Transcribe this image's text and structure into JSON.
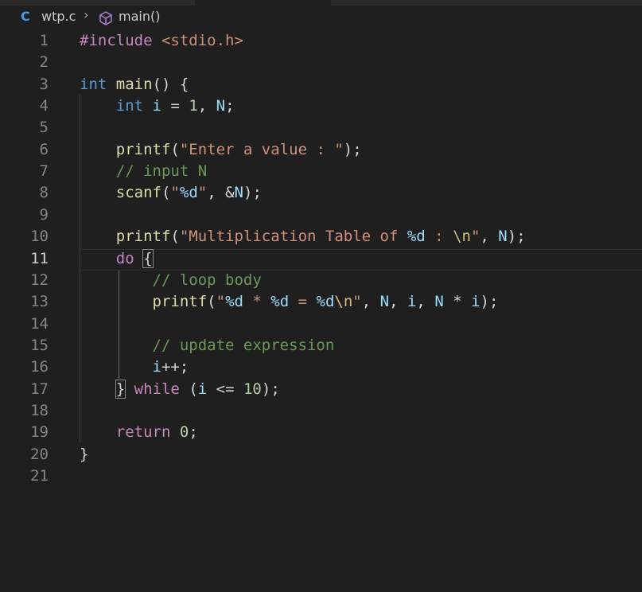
{
  "breadcrumb": {
    "lang_icon": "C",
    "file": "wtp.c",
    "separator": "›",
    "symbol_icon": "cube-icon",
    "symbol": "main()"
  },
  "editor": {
    "current_line": 11,
    "lines": [
      {
        "n": "1",
        "tokens": [
          {
            "t": "#include ",
            "c": "pre"
          },
          {
            "t": "<stdio.h>",
            "c": "str"
          }
        ]
      },
      {
        "n": "2",
        "tokens": []
      },
      {
        "n": "3",
        "tokens": [
          {
            "t": "int",
            "c": "kw"
          },
          {
            "t": " ",
            "c": "txt"
          },
          {
            "t": "main",
            "c": "fn"
          },
          {
            "t": "() {",
            "c": "txt"
          }
        ]
      },
      {
        "n": "4",
        "tokens": [
          {
            "t": "    ",
            "c": "txt"
          },
          {
            "t": "int",
            "c": "kw"
          },
          {
            "t": " ",
            "c": "txt"
          },
          {
            "t": "i",
            "c": "var"
          },
          {
            "t": " = ",
            "c": "txt"
          },
          {
            "t": "1",
            "c": "num"
          },
          {
            "t": ", ",
            "c": "txt"
          },
          {
            "t": "N",
            "c": "var"
          },
          {
            "t": ";",
            "c": "txt"
          }
        ]
      },
      {
        "n": "5",
        "tokens": []
      },
      {
        "n": "6",
        "tokens": [
          {
            "t": "    ",
            "c": "txt"
          },
          {
            "t": "printf",
            "c": "fn"
          },
          {
            "t": "(",
            "c": "txt"
          },
          {
            "t": "\"Enter a value : \"",
            "c": "str"
          },
          {
            "t": ");",
            "c": "txt"
          }
        ]
      },
      {
        "n": "7",
        "tokens": [
          {
            "t": "    ",
            "c": "txt"
          },
          {
            "t": "// input N",
            "c": "cmt"
          }
        ]
      },
      {
        "n": "8",
        "tokens": [
          {
            "t": "    ",
            "c": "txt"
          },
          {
            "t": "scanf",
            "c": "fn"
          },
          {
            "t": "(",
            "c": "txt"
          },
          {
            "t": "\"",
            "c": "str"
          },
          {
            "t": "%d",
            "c": "fmt"
          },
          {
            "t": "\"",
            "c": "str"
          },
          {
            "t": ", &",
            "c": "txt"
          },
          {
            "t": "N",
            "c": "var"
          },
          {
            "t": ");",
            "c": "txt"
          }
        ]
      },
      {
        "n": "9",
        "tokens": []
      },
      {
        "n": "10",
        "tokens": [
          {
            "t": "    ",
            "c": "txt"
          },
          {
            "t": "printf",
            "c": "fn"
          },
          {
            "t": "(",
            "c": "txt"
          },
          {
            "t": "\"Multiplication Table of ",
            "c": "str"
          },
          {
            "t": "%d",
            "c": "fmt"
          },
          {
            "t": " : ",
            "c": "str"
          },
          {
            "t": "\\n",
            "c": "esc"
          },
          {
            "t": "\"",
            "c": "str"
          },
          {
            "t": ", ",
            "c": "txt"
          },
          {
            "t": "N",
            "c": "var"
          },
          {
            "t": ");",
            "c": "txt"
          }
        ]
      },
      {
        "n": "11",
        "tokens": [
          {
            "t": "    ",
            "c": "txt"
          },
          {
            "t": "do",
            "c": "ctl"
          },
          {
            "t": " ",
            "c": "txt"
          },
          {
            "t": "{",
            "c": "txt",
            "box": true
          }
        ]
      },
      {
        "n": "12",
        "tokens": [
          {
            "t": "        ",
            "c": "txt"
          },
          {
            "t": "// loop body",
            "c": "cmt"
          }
        ]
      },
      {
        "n": "13",
        "tokens": [
          {
            "t": "        ",
            "c": "txt"
          },
          {
            "t": "printf",
            "c": "fn"
          },
          {
            "t": "(",
            "c": "txt"
          },
          {
            "t": "\"",
            "c": "str"
          },
          {
            "t": "%d",
            "c": "fmt"
          },
          {
            "t": " * ",
            "c": "str"
          },
          {
            "t": "%d",
            "c": "fmt"
          },
          {
            "t": " = ",
            "c": "str"
          },
          {
            "t": "%d",
            "c": "fmt"
          },
          {
            "t": "\\n",
            "c": "esc"
          },
          {
            "t": "\"",
            "c": "str"
          },
          {
            "t": ", ",
            "c": "txt"
          },
          {
            "t": "N",
            "c": "var"
          },
          {
            "t": ", ",
            "c": "txt"
          },
          {
            "t": "i",
            "c": "var"
          },
          {
            "t": ", ",
            "c": "txt"
          },
          {
            "t": "N",
            "c": "var"
          },
          {
            "t": " * ",
            "c": "txt"
          },
          {
            "t": "i",
            "c": "var"
          },
          {
            "t": ");",
            "c": "txt"
          }
        ]
      },
      {
        "n": "14",
        "tokens": []
      },
      {
        "n": "15",
        "tokens": [
          {
            "t": "        ",
            "c": "txt"
          },
          {
            "t": "// update expression",
            "c": "cmt"
          }
        ]
      },
      {
        "n": "16",
        "tokens": [
          {
            "t": "        ",
            "c": "txt"
          },
          {
            "t": "i",
            "c": "var"
          },
          {
            "t": "++;",
            "c": "txt"
          }
        ]
      },
      {
        "n": "17",
        "tokens": [
          {
            "t": "    ",
            "c": "txt"
          },
          {
            "t": "}",
            "c": "txt",
            "box": true
          },
          {
            "t": " ",
            "c": "txt"
          },
          {
            "t": "while",
            "c": "ctl"
          },
          {
            "t": " (",
            "c": "txt"
          },
          {
            "t": "i",
            "c": "var"
          },
          {
            "t": " <= ",
            "c": "txt"
          },
          {
            "t": "10",
            "c": "num"
          },
          {
            "t": ");",
            "c": "txt"
          }
        ]
      },
      {
        "n": "18",
        "tokens": []
      },
      {
        "n": "19",
        "tokens": [
          {
            "t": "    ",
            "c": "txt"
          },
          {
            "t": "return",
            "c": "ctl"
          },
          {
            "t": " ",
            "c": "txt"
          },
          {
            "t": "0",
            "c": "num"
          },
          {
            "t": ";",
            "c": "txt"
          }
        ]
      },
      {
        "n": "20",
        "tokens": [
          {
            "t": "}",
            "c": "txt"
          }
        ]
      },
      {
        "n": "21",
        "tokens": []
      }
    ]
  }
}
